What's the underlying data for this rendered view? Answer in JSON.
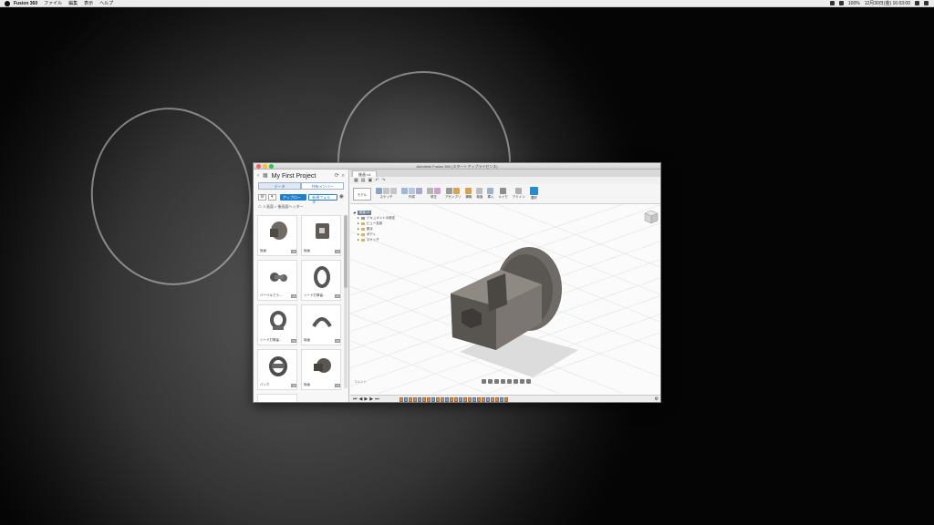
{
  "menubar": {
    "items": [
      "Fusion 360",
      "ファイル",
      "編集",
      "表示",
      "ヘルプ"
    ],
    "clock": "12月30日(金) 16:03:00",
    "battery": "100%"
  },
  "window": {
    "title": "Autodesk Fusion 360 (スタートアップライセンス)"
  },
  "data_panel": {
    "project_title": "My First Project",
    "tabs": [
      "データ",
      "共有メンバー"
    ],
    "upload_label": "アップロード",
    "new_folder_label": "新規フォルダ",
    "breadcrumb": "2 画面 > 後画面ヘッダー",
    "thumbnails": [
      {
        "name": "後画",
        "version": "V2"
      },
      {
        "name": "後画",
        "version": "V2"
      },
      {
        "name": "バーベルクラ...",
        "version": "V2"
      },
      {
        "name": "シード打撃留...",
        "version": "V2"
      },
      {
        "name": "シード打撃留...",
        "version": "V2"
      },
      {
        "name": "後画",
        "version": "V2"
      },
      {
        "name": "バック",
        "version": "V2"
      },
      {
        "name": "後画",
        "version": "V2"
      }
    ]
  },
  "workspace": {
    "doc_tab": "後画 v4",
    "mode_label": "モデル",
    "toolbar_groups": [
      "スケッチ",
      "作成",
      "修正",
      "アセンブリ",
      "構築",
      "検査",
      "挿入",
      "メイク",
      "アドイン",
      "選択"
    ],
    "browser": {
      "root": "後画 v4",
      "items": [
        "ドキュメントの設定",
        "ビュー名前",
        "原点",
        "ボディ",
        "スケッチ"
      ]
    },
    "comments_label": "コメント"
  },
  "colors": {
    "accent_blue": "#1e7fd1",
    "model_gray": "#5a5753",
    "timeline_orange": "#cf8f58"
  }
}
